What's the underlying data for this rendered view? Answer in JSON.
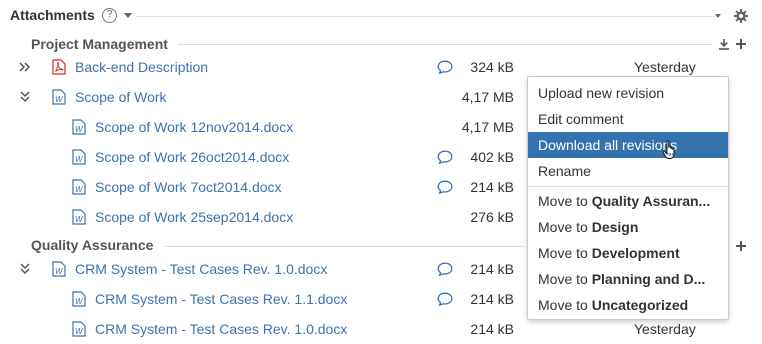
{
  "header": {
    "title": "Attachments",
    "help_glyph": "?"
  },
  "groups": [
    {
      "title": "Project Management"
    },
    {
      "title": "Quality Assurance"
    }
  ],
  "rows": [
    {
      "name": "Back-end Description",
      "size": "324 kB",
      "date": "Yesterday",
      "icon": "pdf-icon",
      "toggle": "expand-icon"
    },
    {
      "name": "Scope of Work",
      "size": "4,17 MB",
      "date": "",
      "icon": "word-icon",
      "toggle": "collapse-icon"
    },
    {
      "name": "Scope of Work 12nov2014.docx",
      "size": "4,17 MB",
      "date": "",
      "icon": "word-icon"
    },
    {
      "name": "Scope of Work 26oct2014.docx",
      "size": "402 kB",
      "date": "",
      "icon": "word-icon"
    },
    {
      "name": "Scope of Work 7oct2014.docx",
      "size": "214 kB",
      "date": "",
      "icon": "word-icon"
    },
    {
      "name": "Scope of Work 25sep2014.docx",
      "size": "276 kB",
      "date": "",
      "icon": "word-icon"
    },
    {
      "name": "CRM System - Test Cases Rev. 1.0.docx",
      "size": "214 kB",
      "date": "",
      "icon": "word-icon",
      "toggle": "collapse-icon"
    },
    {
      "name": "CRM System - Test Cases Rev. 1.1.docx",
      "size": "214 kB",
      "date": "",
      "icon": "word-icon"
    },
    {
      "name": "CRM System - Test Cases Rev. 1.0.docx",
      "size": "214 kB",
      "date": "Yesterday",
      "icon": "word-icon"
    }
  ],
  "menu": {
    "items": [
      {
        "label": "Upload new revision"
      },
      {
        "label": "Edit comment"
      },
      {
        "label": "Download all revisions",
        "selected": true
      },
      {
        "label": "Rename"
      }
    ],
    "move_prefix": "Move to ",
    "move_items": [
      {
        "target": "Quality Assuran..."
      },
      {
        "target": "Design"
      },
      {
        "target": "Development"
      },
      {
        "target": "Planning and D..."
      },
      {
        "target": "Uncategorized"
      }
    ]
  },
  "colors": {
    "link": "#3b73af",
    "selected": "#3572b0",
    "pdf": "#d9261c"
  }
}
